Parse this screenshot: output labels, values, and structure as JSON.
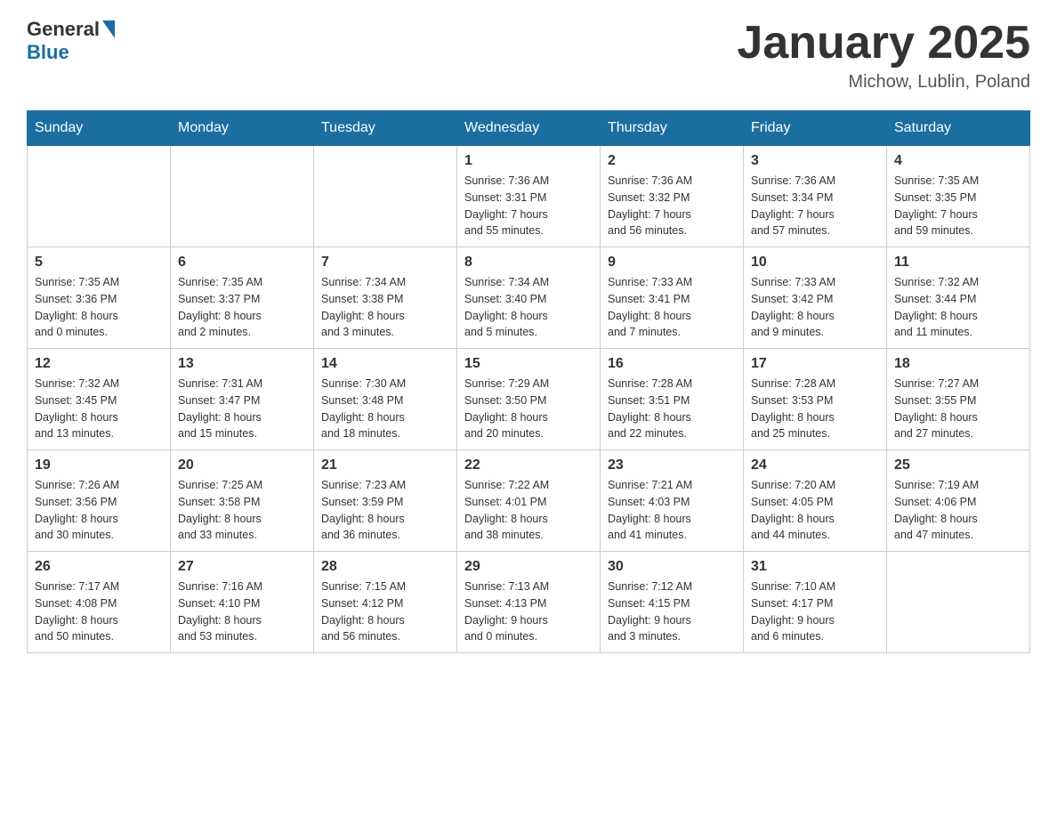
{
  "header": {
    "logo_general": "General",
    "logo_blue": "Blue",
    "month_title": "January 2025",
    "location": "Michow, Lublin, Poland"
  },
  "days_of_week": [
    "Sunday",
    "Monday",
    "Tuesday",
    "Wednesday",
    "Thursday",
    "Friday",
    "Saturday"
  ],
  "weeks": [
    [
      {
        "day": "",
        "info": ""
      },
      {
        "day": "",
        "info": ""
      },
      {
        "day": "",
        "info": ""
      },
      {
        "day": "1",
        "info": "Sunrise: 7:36 AM\nSunset: 3:31 PM\nDaylight: 7 hours\nand 55 minutes."
      },
      {
        "day": "2",
        "info": "Sunrise: 7:36 AM\nSunset: 3:32 PM\nDaylight: 7 hours\nand 56 minutes."
      },
      {
        "day": "3",
        "info": "Sunrise: 7:36 AM\nSunset: 3:34 PM\nDaylight: 7 hours\nand 57 minutes."
      },
      {
        "day": "4",
        "info": "Sunrise: 7:35 AM\nSunset: 3:35 PM\nDaylight: 7 hours\nand 59 minutes."
      }
    ],
    [
      {
        "day": "5",
        "info": "Sunrise: 7:35 AM\nSunset: 3:36 PM\nDaylight: 8 hours\nand 0 minutes."
      },
      {
        "day": "6",
        "info": "Sunrise: 7:35 AM\nSunset: 3:37 PM\nDaylight: 8 hours\nand 2 minutes."
      },
      {
        "day": "7",
        "info": "Sunrise: 7:34 AM\nSunset: 3:38 PM\nDaylight: 8 hours\nand 3 minutes."
      },
      {
        "day": "8",
        "info": "Sunrise: 7:34 AM\nSunset: 3:40 PM\nDaylight: 8 hours\nand 5 minutes."
      },
      {
        "day": "9",
        "info": "Sunrise: 7:33 AM\nSunset: 3:41 PM\nDaylight: 8 hours\nand 7 minutes."
      },
      {
        "day": "10",
        "info": "Sunrise: 7:33 AM\nSunset: 3:42 PM\nDaylight: 8 hours\nand 9 minutes."
      },
      {
        "day": "11",
        "info": "Sunrise: 7:32 AM\nSunset: 3:44 PM\nDaylight: 8 hours\nand 11 minutes."
      }
    ],
    [
      {
        "day": "12",
        "info": "Sunrise: 7:32 AM\nSunset: 3:45 PM\nDaylight: 8 hours\nand 13 minutes."
      },
      {
        "day": "13",
        "info": "Sunrise: 7:31 AM\nSunset: 3:47 PM\nDaylight: 8 hours\nand 15 minutes."
      },
      {
        "day": "14",
        "info": "Sunrise: 7:30 AM\nSunset: 3:48 PM\nDaylight: 8 hours\nand 18 minutes."
      },
      {
        "day": "15",
        "info": "Sunrise: 7:29 AM\nSunset: 3:50 PM\nDaylight: 8 hours\nand 20 minutes."
      },
      {
        "day": "16",
        "info": "Sunrise: 7:28 AM\nSunset: 3:51 PM\nDaylight: 8 hours\nand 22 minutes."
      },
      {
        "day": "17",
        "info": "Sunrise: 7:28 AM\nSunset: 3:53 PM\nDaylight: 8 hours\nand 25 minutes."
      },
      {
        "day": "18",
        "info": "Sunrise: 7:27 AM\nSunset: 3:55 PM\nDaylight: 8 hours\nand 27 minutes."
      }
    ],
    [
      {
        "day": "19",
        "info": "Sunrise: 7:26 AM\nSunset: 3:56 PM\nDaylight: 8 hours\nand 30 minutes."
      },
      {
        "day": "20",
        "info": "Sunrise: 7:25 AM\nSunset: 3:58 PM\nDaylight: 8 hours\nand 33 minutes."
      },
      {
        "day": "21",
        "info": "Sunrise: 7:23 AM\nSunset: 3:59 PM\nDaylight: 8 hours\nand 36 minutes."
      },
      {
        "day": "22",
        "info": "Sunrise: 7:22 AM\nSunset: 4:01 PM\nDaylight: 8 hours\nand 38 minutes."
      },
      {
        "day": "23",
        "info": "Sunrise: 7:21 AM\nSunset: 4:03 PM\nDaylight: 8 hours\nand 41 minutes."
      },
      {
        "day": "24",
        "info": "Sunrise: 7:20 AM\nSunset: 4:05 PM\nDaylight: 8 hours\nand 44 minutes."
      },
      {
        "day": "25",
        "info": "Sunrise: 7:19 AM\nSunset: 4:06 PM\nDaylight: 8 hours\nand 47 minutes."
      }
    ],
    [
      {
        "day": "26",
        "info": "Sunrise: 7:17 AM\nSunset: 4:08 PM\nDaylight: 8 hours\nand 50 minutes."
      },
      {
        "day": "27",
        "info": "Sunrise: 7:16 AM\nSunset: 4:10 PM\nDaylight: 8 hours\nand 53 minutes."
      },
      {
        "day": "28",
        "info": "Sunrise: 7:15 AM\nSunset: 4:12 PM\nDaylight: 8 hours\nand 56 minutes."
      },
      {
        "day": "29",
        "info": "Sunrise: 7:13 AM\nSunset: 4:13 PM\nDaylight: 9 hours\nand 0 minutes."
      },
      {
        "day": "30",
        "info": "Sunrise: 7:12 AM\nSunset: 4:15 PM\nDaylight: 9 hours\nand 3 minutes."
      },
      {
        "day": "31",
        "info": "Sunrise: 7:10 AM\nSunset: 4:17 PM\nDaylight: 9 hours\nand 6 minutes."
      },
      {
        "day": "",
        "info": ""
      }
    ]
  ]
}
